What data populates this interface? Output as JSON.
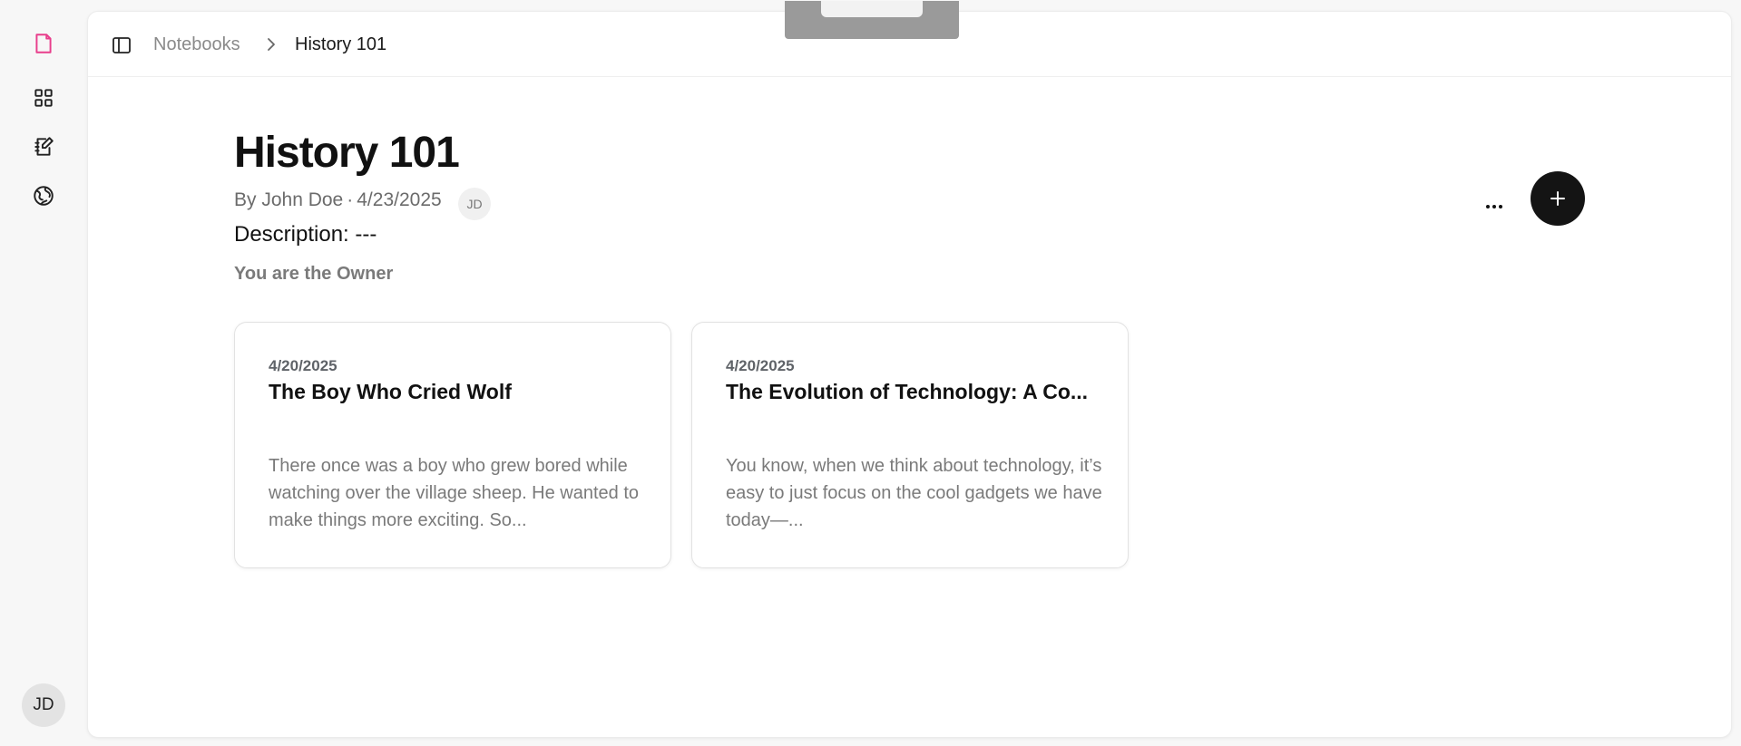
{
  "rail": {
    "items": [
      {
        "icon": "note-icon",
        "active": true
      },
      {
        "icon": "grid-icon",
        "active": false
      },
      {
        "icon": "notebook-edit-icon",
        "active": false
      },
      {
        "icon": "globe-icon",
        "active": false
      }
    ],
    "avatar_initials": "JD",
    "accent_color": "#e83e8c"
  },
  "breadcrumb": {
    "parent": "Notebooks",
    "current": "History 101"
  },
  "notebook": {
    "title": "History 101",
    "author": "By John Doe",
    "separator": "·",
    "date": "4/23/2025",
    "author_initials": "JD",
    "description": "Description: ---",
    "role": "You are the Owner"
  },
  "actions": {
    "more_icon": "more-horizontal-icon",
    "add_icon": "plus-icon"
  },
  "notes": [
    {
      "date": "4/20/2025",
      "title": "The Boy Who Cried Wolf",
      "excerpt": "There once was a boy who grew bored while watching over the village sheep. He wanted to make things more exciting. So..."
    },
    {
      "date": "4/20/2025",
      "title": "The Evolution of Technology: A Co...",
      "excerpt": "You know, when we think about technology, it’s easy to just focus on the cool gadgets we have today—..."
    }
  ]
}
